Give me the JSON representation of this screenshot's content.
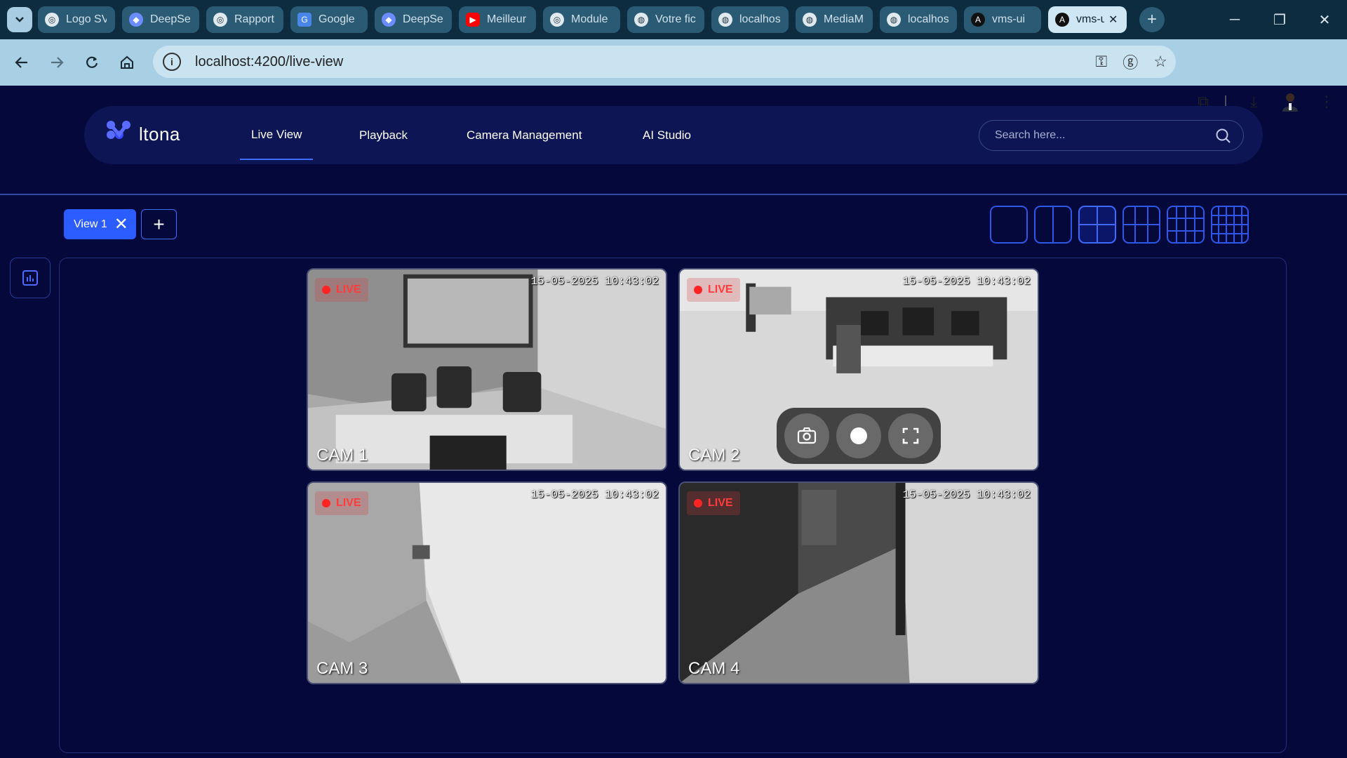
{
  "browser": {
    "tabs": [
      {
        "title": "Logo SVG",
        "icon": "chatgpt-icon"
      },
      {
        "title": "DeepSeek",
        "icon": "deepseek-icon"
      },
      {
        "title": "Rapport",
        "icon": "chatgpt-icon"
      },
      {
        "title": "Google",
        "icon": "google-translate-icon"
      },
      {
        "title": "DeepSeek",
        "icon": "deepseek-icon"
      },
      {
        "title": "Meilleur",
        "icon": "youtube-icon"
      },
      {
        "title": "Module",
        "icon": "chatgpt-icon"
      },
      {
        "title": "Votre fic",
        "icon": "globe-icon"
      },
      {
        "title": "localhost",
        "icon": "globe-icon"
      },
      {
        "title": "MediaM",
        "icon": "globe-icon"
      },
      {
        "title": "localhost",
        "icon": "globe-icon"
      },
      {
        "title": "vms-ui",
        "icon": "angular-icon"
      },
      {
        "title": "vms-ui",
        "icon": "angular-icon",
        "active": true
      }
    ],
    "url": "localhost:4200/live-view"
  },
  "app": {
    "logo_text": "ltona",
    "nav": [
      {
        "label": "Live View",
        "active": true
      },
      {
        "label": "Playback"
      },
      {
        "label": "Camera Management"
      },
      {
        "label": "AI Studio"
      }
    ],
    "search_placeholder": "Search here...",
    "view_tab": "View 1",
    "layouts": [
      "1x1",
      "1x2",
      "2x2",
      "3x3",
      "4x4",
      "5x5"
    ],
    "active_layout": "2x2"
  },
  "cameras": [
    {
      "name": "CAM 1",
      "timestamp": "15-05-2025 10:43:02",
      "status": "LIVE"
    },
    {
      "name": "CAM 2",
      "timestamp": "15-05-2025 10:43:02",
      "status": "LIVE"
    },
    {
      "name": "CAM 3",
      "timestamp": "15-05-2025 10:43:02",
      "status": "LIVE"
    },
    {
      "name": "CAM 4",
      "timestamp": "15-05-2025 10:43:02",
      "status": "LIVE"
    }
  ],
  "colors": {
    "background": "#05083a",
    "accent": "#2a5cff",
    "live": "#ff2424"
  }
}
